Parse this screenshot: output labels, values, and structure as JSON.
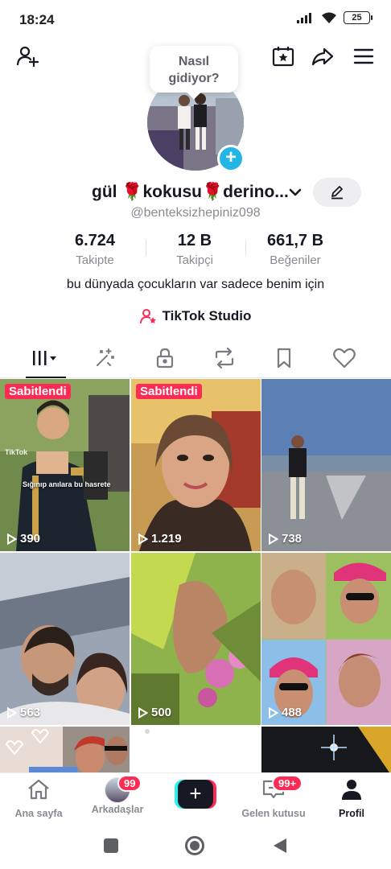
{
  "status": {
    "time": "18:24",
    "battery": "25"
  },
  "bubble": {
    "text_line1": "Nasıl",
    "text_line2": "gidiyor?"
  },
  "profile": {
    "display_name": "gül 🌹kokusu🌹derino...",
    "username": "@benteksizhepiniz098",
    "bio": "bu dünyada çocukların var sadece benim için",
    "studio_label": "TikTok Studio"
  },
  "stats": [
    {
      "value": "6.724",
      "label": "Takipte"
    },
    {
      "value": "12 B",
      "label": "Takipçi"
    },
    {
      "value": "661,7 B",
      "label": "Beğeniler"
    }
  ],
  "tabs": [
    {
      "icon": "grid-icon",
      "active": true
    },
    {
      "icon": "reposts-sparkle-icon",
      "active": false
    },
    {
      "icon": "lock-icon",
      "active": false
    },
    {
      "icon": "repost-icon",
      "active": false
    },
    {
      "icon": "bookmark-icon",
      "active": false
    },
    {
      "icon": "heart-icon",
      "active": false
    }
  ],
  "videos": [
    {
      "views": "390",
      "pinned": "Sabitlendi",
      "caption": "Sığınıp anılara bu hasrete",
      "watermark": "TikTok"
    },
    {
      "views": "1.219",
      "pinned": "Sabitlendi"
    },
    {
      "views": "738"
    },
    {
      "views": "563"
    },
    {
      "views": "500"
    },
    {
      "views": "488"
    },
    {
      "views": ""
    },
    {
      "views": ""
    },
    {
      "views": ""
    }
  ],
  "bottom_nav": {
    "home": "Ana sayfa",
    "friends": "Arkadaşlar",
    "friends_badge": "99",
    "inbox": "Gelen kutusu",
    "inbox_badge": "99+",
    "profile": "Profil"
  },
  "colors": {
    "accent": "#fe2c55",
    "cyan": "#25f4ee",
    "text": "#161823",
    "secondary": "#8a8b91"
  }
}
